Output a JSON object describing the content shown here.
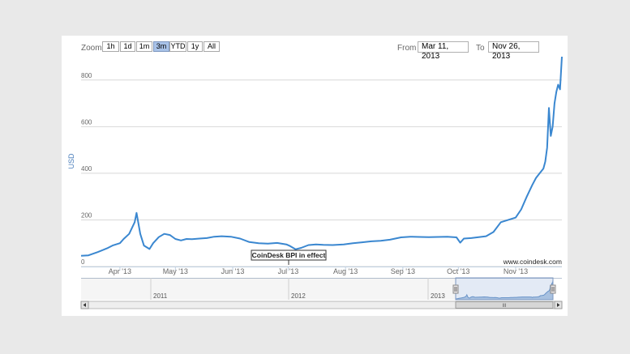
{
  "toolbar": {
    "zoom_label": "Zoom",
    "zoom_buttons": [
      "1h",
      "1d",
      "1m",
      "3m",
      "YTD",
      "1y",
      "All"
    ],
    "active_zoom": "3m",
    "from_label": "From",
    "from_value": "Mar 11, 2013",
    "to_label": "To",
    "to_value": "Nov 26, 2013"
  },
  "credit": "www.coindesk.com",
  "navigator": {
    "years": [
      "2011",
      "2012",
      "2013"
    ],
    "scroll_grip": "III"
  },
  "colors": {
    "line": "#3a87d0",
    "grid": "#d8d8d8",
    "axis_text": "#666666",
    "ylabel": "#4a7ebb",
    "active_button": "#a8c2e8"
  },
  "chart_data": {
    "type": "line",
    "title": "",
    "xlabel": "",
    "ylabel": "USD",
    "ylim": [
      0,
      900
    ],
    "yticks": [
      0,
      200,
      400,
      600,
      800
    ],
    "xticks": [
      "Apr '13",
      "May '13",
      "Jun '13",
      "Jul '13",
      "Aug '13",
      "Sep '13",
      "Oct '13",
      "Nov '13"
    ],
    "grid": true,
    "legend": "none",
    "annotation": "CoinDesk BPI in effect",
    "series": [
      {
        "x": [
          "2013-03-11",
          "2013-03-15",
          "2013-03-20",
          "2013-03-25",
          "2013-03-28",
          "2013-04-01",
          "2013-04-03",
          "2013-04-06",
          "2013-04-09",
          "2013-04-10",
          "2013-04-12",
          "2013-04-14",
          "2013-04-17",
          "2013-04-19",
          "2013-04-22",
          "2013-04-25",
          "2013-04-28",
          "2013-05-01",
          "2013-05-04",
          "2013-05-07",
          "2013-05-10",
          "2013-05-14",
          "2013-05-18",
          "2013-05-22",
          "2013-05-26",
          "2013-05-31",
          "2013-06-05",
          "2013-06-10",
          "2013-06-15",
          "2013-06-20",
          "2013-06-25",
          "2013-06-30",
          "2013-07-02",
          "2013-07-05",
          "2013-07-08",
          "2013-07-12",
          "2013-07-16",
          "2013-07-20",
          "2013-07-25",
          "2013-07-31",
          "2013-08-05",
          "2013-08-10",
          "2013-08-15",
          "2013-08-20",
          "2013-08-25",
          "2013-08-31",
          "2013-09-05",
          "2013-09-10",
          "2013-09-15",
          "2013-09-20",
          "2013-09-25",
          "2013-09-30",
          "2013-10-02",
          "2013-10-04",
          "2013-10-08",
          "2013-10-12",
          "2013-10-16",
          "2013-10-20",
          "2013-10-24",
          "2013-10-28",
          "2013-11-01",
          "2013-11-04",
          "2013-11-07",
          "2013-11-10",
          "2013-11-12",
          "2013-11-14",
          "2013-11-16",
          "2013-11-17",
          "2013-11-18",
          "2013-11-19",
          "2013-11-20",
          "2013-11-21",
          "2013-11-22",
          "2013-11-23",
          "2013-11-24",
          "2013-11-25",
          "2013-11-26"
        ],
        "y": [
          46,
          48,
          62,
          78,
          90,
          100,
          118,
          140,
          190,
          230,
          140,
          90,
          75,
          100,
          126,
          140,
          135,
          118,
          112,
          118,
          117,
          120,
          122,
          128,
          130,
          128,
          120,
          105,
          100,
          98,
          101,
          95,
          88,
          74,
          80,
          92,
          95,
          93,
          92,
          95,
          100,
          104,
          108,
          110,
          115,
          125,
          128,
          127,
          126,
          127,
          128,
          125,
          102,
          120,
          122,
          126,
          130,
          148,
          190,
          200,
          210,
          245,
          300,
          350,
          380,
          400,
          420,
          450,
          510,
          680,
          560,
          600,
          700,
          750,
          780,
          760,
          900
        ]
      }
    ]
  }
}
